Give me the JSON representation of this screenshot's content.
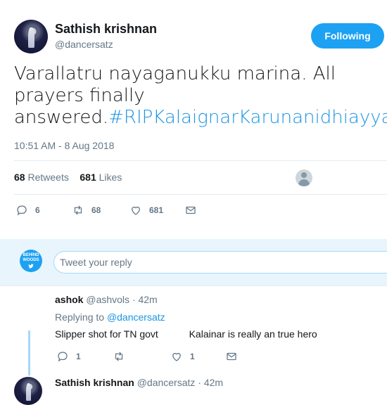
{
  "tweet": {
    "author_name": "Sathish krishnan",
    "author_handle": "@dancersatz",
    "follow_label": "Following",
    "text_main": "Varallatru nayaganukku marina. All prayers finally answered.",
    "hashtag": "#RIPKalaignarKarunanidhiayya",
    "timestamp": "10:51 AM - 8 Aug 2018",
    "retweets_count": "68",
    "retweets_label": "Retweets",
    "likes_count": "681",
    "likes_label": "Likes",
    "actions": {
      "reply_count": "6",
      "retweet_count": "68",
      "like_count": "681"
    }
  },
  "reply_box": {
    "placeholder": "Tweet your reply",
    "avatar_text_1": "BEHIND",
    "avatar_text_2": "WOODS"
  },
  "replies": [
    {
      "name": "ashok",
      "handle": "@ashvols",
      "time": "· 42m",
      "replying_prefix": "Replying to",
      "replying_to": "@dancersatz",
      "text_part1": "Slipper shot for TN govt",
      "text_part2": "Kalainar is really an true hero",
      "reply_count": "1",
      "like_count": "1"
    },
    {
      "name": "Sathish krishnan",
      "handle": "@dancersatz",
      "time": "· 42m"
    }
  ],
  "colors": {
    "accent": "#1da1f2",
    "link": "#1b95e0",
    "muted": "#657786"
  }
}
